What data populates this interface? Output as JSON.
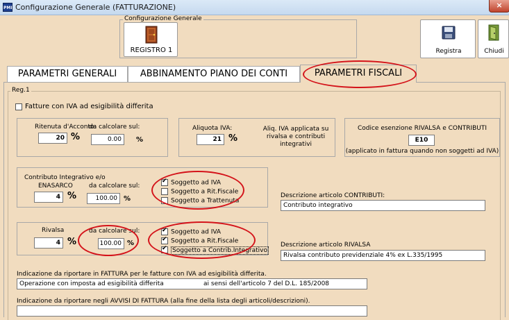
{
  "window": {
    "app_icon": "PMI",
    "title": "Configurazione Generale (FATTURAZIONE)",
    "close_label": "×"
  },
  "header": {
    "group_label": "Configurazione Generale",
    "registro_label": "REGISTRO 1",
    "registra_label": "Registra",
    "chiudi_label": "Chiudi"
  },
  "tabs": [
    {
      "label": "PARAMETRI GENERALI",
      "active": false
    },
    {
      "label": "ABBINAMENTO PIANO DEI CONTI",
      "active": false
    },
    {
      "label": "PARAMETRI FISCALI",
      "active": true
    }
  ],
  "panel": {
    "reg_label": "Reg.1",
    "iva_differita_label": "Fatture con IVA ad esigibilità differita",
    "iva_differita_checked": false,
    "ritenuta": {
      "label": "Ritenuta d'Acconto:",
      "value": "20",
      "pct": "%",
      "calc_label": "da calcolare sul:",
      "calc_value": "0.00",
      "calc_pct": "%"
    },
    "aliquota": {
      "label": "Aliquota IVA:",
      "value": "21",
      "pct": "%",
      "note": "Aliq. IVA applicata su rivalsa e contributi integrativi"
    },
    "esenzione": {
      "label": "Codice esenzione RIVALSA e CONTRIBUTI",
      "value": "E10",
      "note": "(applicato in fattura quando non soggetti ad IVA)"
    },
    "contributo": {
      "label_line1": "Contributo Integrativo e/o",
      "label_line2": "ENASARCO",
      "value": "4",
      "pct": "%",
      "calc_label": "da calcolare sul:",
      "calc_value": "100.00",
      "calc_pct": "%",
      "checks": [
        {
          "label": "Soggetto ad IVA",
          "checked": true
        },
        {
          "label": "Soggetto a Rit.Fiscale",
          "checked": false
        },
        {
          "label": "Soggetto a Trattenuta",
          "checked": false
        }
      ],
      "desc_label": "Descrizione articolo CONTRIBUTI:",
      "desc_value": "Contributo integrativo"
    },
    "rivalsa": {
      "label": "Rivalsa",
      "value": "4",
      "pct": "%",
      "calc_label": "da calcolare sul:",
      "calc_value": "100.00",
      "calc_pct": "%",
      "checks": [
        {
          "label": "Soggetto ad IVA",
          "checked": true
        },
        {
          "label": "Soggetto a Rit.Fiscale",
          "checked": true
        },
        {
          "label": "Soggetto a Contrib.Integrativo",
          "checked": true
        }
      ],
      "desc_label": "Descrizione articolo RIVALSA",
      "desc_value": "Rivalsa contributo previdenziale 4% ex L.335/1995"
    },
    "fattura_note_label": "Indicazione da riportare in FATTURA per le fatture con IVA ad esigibilità differita.",
    "fattura_note_value": "Operazione con imposta ad esigibilità differita                    ai sensi dell'articolo 7 del D.L. 185/2008",
    "avvisi_note_label": "Indicazione da riportare negli AVVISI DI FATTURA (alla fine della lista degli articoli/descrizioni).",
    "avvisi_note_value": ""
  },
  "colors": {
    "panel_bg": "#f1dcbf",
    "highlight_red": "#d4131a"
  }
}
